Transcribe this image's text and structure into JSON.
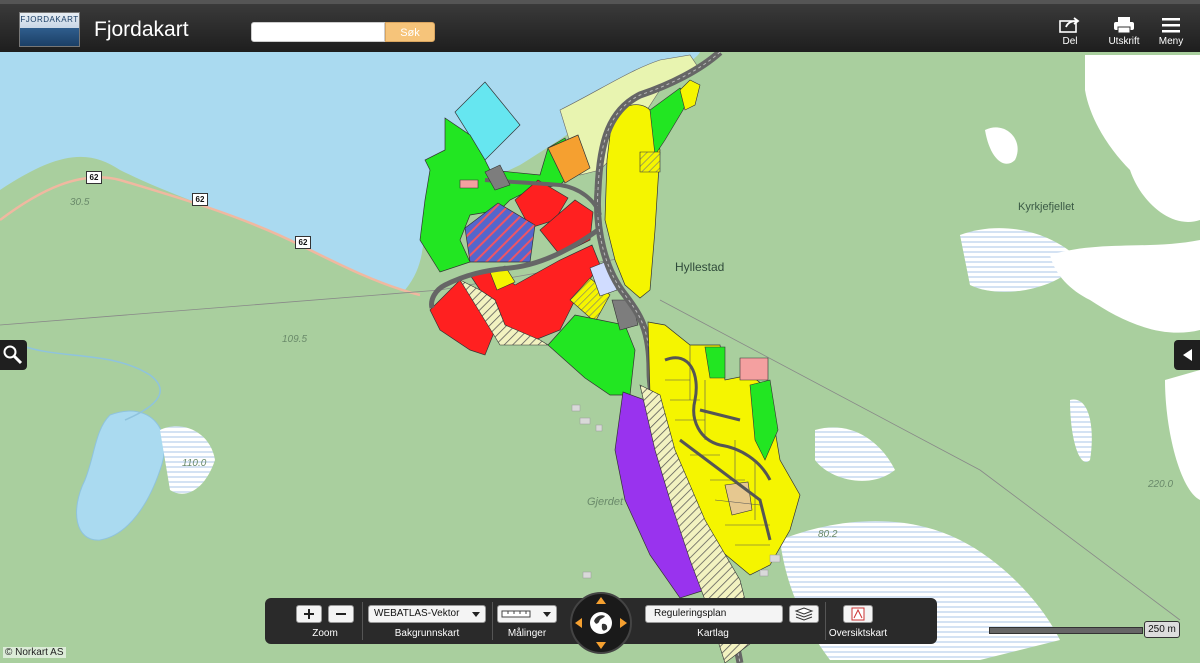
{
  "header": {
    "logo_text": "FJORDAKART",
    "title": "Fjordakart",
    "search_placeholder": "",
    "search_button": "Søk",
    "share_label": "Del",
    "print_label": "Utskrift",
    "menu_label": "Meny"
  },
  "map": {
    "places": {
      "hyllestad": "Hyllestad",
      "kyrkjefjellet": "Kyrkjefjellet",
      "gjerdet": "Gjerdet"
    },
    "elevations": {
      "e1": "30.5",
      "e2": "109.5",
      "e3": "110.0",
      "e4": "220.0",
      "e5": "80.2"
    },
    "road_numbers": [
      "62",
      "62",
      "62"
    ]
  },
  "toolbar": {
    "zoom_label": "Zoom",
    "basemap_value": "WEBATLAS-Vektor",
    "basemap_label": "Bakgrunnskart",
    "measure_label": "Målinger",
    "layer_value": "Reguleringsplan",
    "layer_label": "Kartlag",
    "overview_label": "Oversiktskart"
  },
  "scale": {
    "value": "250 m"
  },
  "credit": "© Norkart AS",
  "icons": [
    "share-icon",
    "print-icon",
    "menu-icon",
    "search-icon",
    "arrow-left-icon",
    "zoom-in-icon",
    "zoom-out-icon",
    "chevron-down-icon",
    "ruler-icon",
    "compass-icon",
    "layers-icon",
    "overview-map-icon"
  ],
  "colors": {
    "water": "#aadaf0",
    "land": "#a9cf9e",
    "residential": "#f5f500",
    "commercial": "#ff2020",
    "green": "#22e622",
    "purple": "#9933ee",
    "cyan": "#66e6f0",
    "orange": "#f5a030",
    "road": "#7d7d7d",
    "search_button": "#f6c47a",
    "toolbar": "#2a2a2a"
  }
}
